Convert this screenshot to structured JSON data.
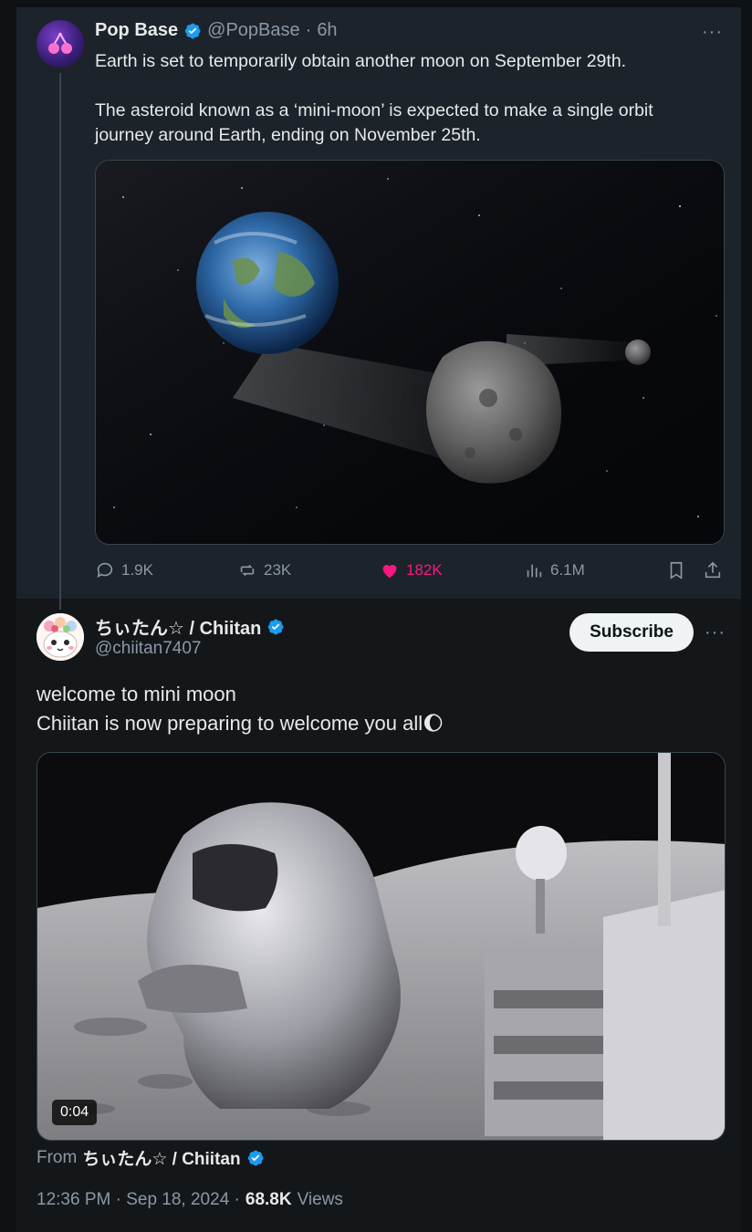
{
  "parent_tweet": {
    "author_name": "Pop Base",
    "handle": "@PopBase",
    "separator": "·",
    "time": "6h",
    "more": "···",
    "text_line1": "Earth is set to temporarily obtain another moon on September 29th.",
    "text_line2": "The asteroid known as a ‘mini-moon’ is expected to make a single orbit journey around Earth, ending on November 25th.",
    "actions": {
      "replies": "1.9K",
      "reposts": "23K",
      "likes": "182K",
      "views": "6.1M"
    }
  },
  "tweet": {
    "author_name": "ちぃたん☆ / Chiitan",
    "handle": "@chiitan7407",
    "subscribe_label": "Subscribe",
    "more": "···",
    "text_line1": "welcome to mini moon",
    "text_line2": "Chiitan is now preparing to welcome you all🌔",
    "video_duration": "0:04",
    "from_label": "From",
    "from_name": "ちぃたん☆ / Chiitan",
    "timestamp": "12:36 PM · Sep 18, 2024 ·",
    "views_count": "68.8K",
    "views_label": "Views"
  },
  "colors": {
    "background": "#14171a",
    "verified": "#1d9bf0",
    "like": "#f91880",
    "muted": "#8b98a5"
  }
}
